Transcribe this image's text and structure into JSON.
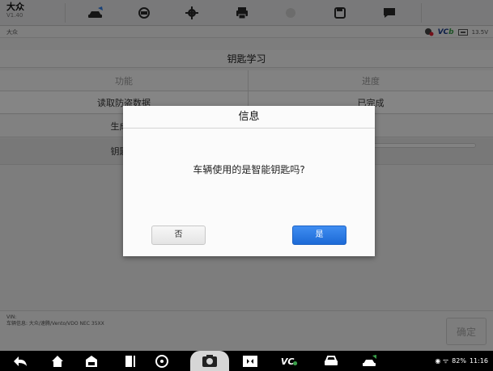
{
  "app": {
    "title": "大众",
    "version": "V1.40"
  },
  "toolbar": {
    "icons": [
      "home-car-icon",
      "vehicle-swap-icon",
      "settings-gear-icon",
      "print-icon",
      "help-icon",
      "save-icon",
      "message-icon"
    ]
  },
  "subbar": {
    "breadcrumb": "大众",
    "vci_label": "VC",
    "voltage": "13.5V"
  },
  "page": {
    "title": "钥匙学习",
    "columns": [
      "功能",
      "进度"
    ],
    "rows": [
      {
        "function": "读取防盗数据",
        "status": "已完成"
      },
      {
        "function": "生成经",
        "status": "成"
      },
      {
        "function": "钥匙匹",
        "status": "%",
        "progress": 0
      }
    ]
  },
  "footer": {
    "vin_label": "VIN:",
    "vehicle_info": "车辆信息: 大众/速腾/Vento/VDO NEC 35XX",
    "confirm_label": "确定"
  },
  "dialog": {
    "title": "信息",
    "message": "车辆使用的是智能钥匙吗?",
    "no_label": "否",
    "yes_label": "是"
  },
  "statusbar": {
    "battery": "82%",
    "time": "11:16"
  },
  "colors": {
    "accent": "#2f7ee6",
    "overlay": "#000000"
  }
}
